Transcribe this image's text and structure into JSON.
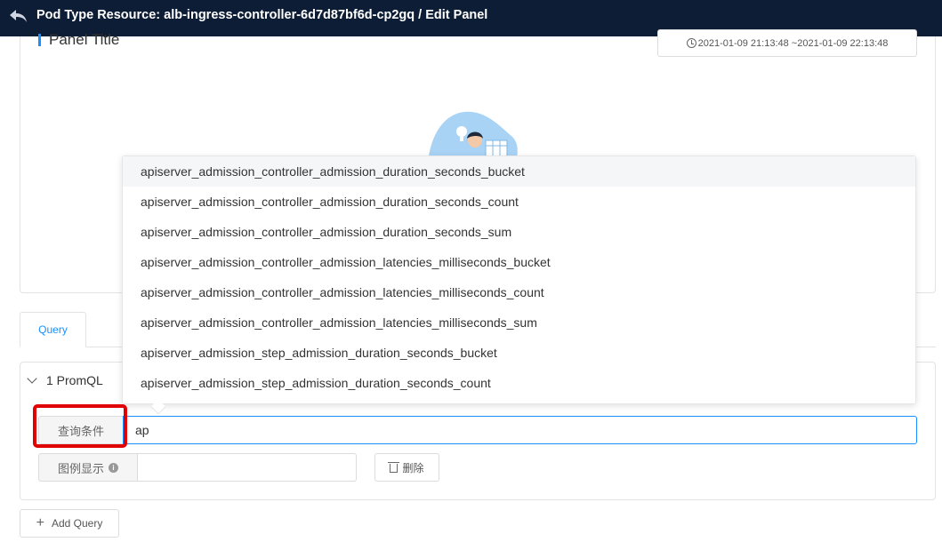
{
  "header": {
    "title": "Pod Type Resource: alb-ingress-controller-6d7d87bf6d-cp2gq / Edit Panel",
    "background": "#0d1d35"
  },
  "panel": {
    "title": "Panel Title",
    "time_range": "2021-01-09 21:13:48 ~2021-01-09 22:13:48"
  },
  "autocomplete": {
    "items": [
      "apiserver_admission_controller_admission_duration_seconds_bucket",
      "apiserver_admission_controller_admission_duration_seconds_count",
      "apiserver_admission_controller_admission_duration_seconds_sum",
      "apiserver_admission_controller_admission_latencies_milliseconds_bucket",
      "apiserver_admission_controller_admission_latencies_milliseconds_count",
      "apiserver_admission_controller_admission_latencies_milliseconds_sum",
      "apiserver_admission_step_admission_duration_seconds_bucket",
      "apiserver_admission_step_admission_duration_seconds_count"
    ]
  },
  "tabs": [
    {
      "label": "Query"
    }
  ],
  "query_block": {
    "header": "1 PromQL",
    "query_label": "查询条件",
    "query_value": "ap",
    "legend_label": "图例显示",
    "legend_value": "",
    "delete_label": "删除"
  },
  "add_query_label": "Add Query",
  "colors": {
    "accent": "#1890ff",
    "highlight": "#e10000"
  }
}
